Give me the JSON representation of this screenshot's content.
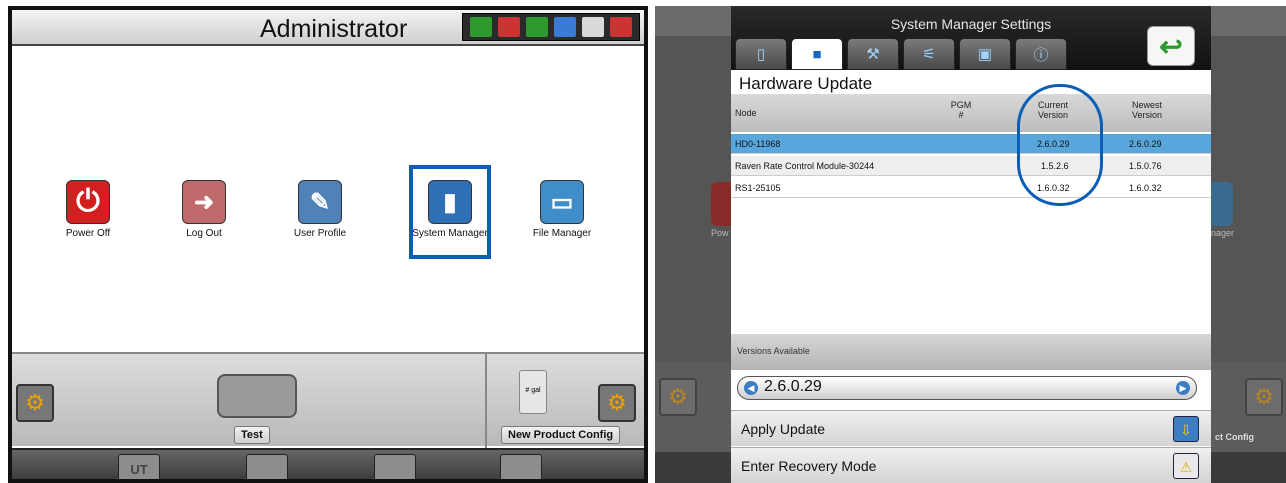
{
  "left": {
    "title": "Administrator",
    "apps": [
      {
        "label": "Power Off",
        "color": "#d21f1f",
        "glyph": "⏻"
      },
      {
        "label": "Log Out",
        "color": "#c65a5a",
        "glyph": "➜"
      },
      {
        "label": "User Profile",
        "color": "#4f83b8",
        "glyph": "✎"
      },
      {
        "label": "System Manager",
        "color": "#2f6fb5",
        "glyph": "▮"
      },
      {
        "label": "File Manager",
        "color": "#3f8ec9",
        "glyph": "▭"
      }
    ],
    "panel": {
      "left_button": "Test",
      "right_button": "New Product Config",
      "product_tag": "# gal"
    },
    "bottom": [
      "UT",
      "",
      "",
      ""
    ]
  },
  "right": {
    "dialog_title": "System Manager Settings",
    "section_title": "Hardware Update",
    "columns": {
      "node": "Node",
      "pgm": "PGM #",
      "current": "Current Version",
      "newest": "Newest Version"
    },
    "rows": [
      {
        "node": "HD0-11968",
        "pgm": "",
        "current": "2.6.0.29",
        "newest": "2.6.0.29"
      },
      {
        "node": "Raven Rate Control Module-30244",
        "pgm": "",
        "current": "1.5.2.6",
        "newest": "1.5.0.76"
      },
      {
        "node": "RS1-25105",
        "pgm": "",
        "current": "1.6.0.32",
        "newest": "1.6.0.32"
      }
    ],
    "versions_label": "Versions Available",
    "selected_version": "2.6.0.29",
    "apply_update": "Apply Update",
    "recovery_mode": "Enter Recovery Mode",
    "bg_labels": {
      "power": "Pow",
      "manager": "nager",
      "config": "ct Config"
    }
  }
}
